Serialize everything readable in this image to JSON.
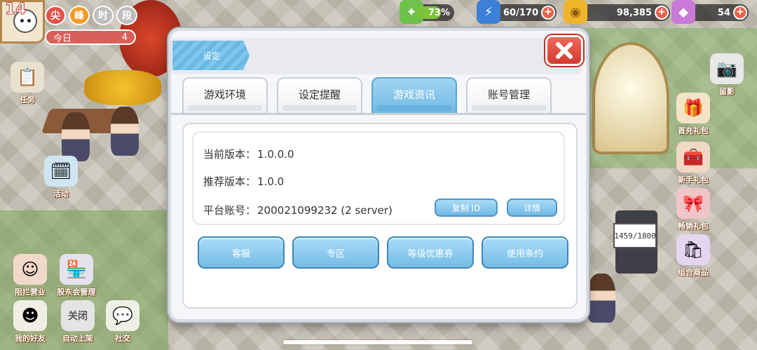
{
  "hud": {
    "level": "14",
    "badges": [
      "尖",
      "峰",
      "时",
      "段"
    ],
    "today_label": "今日",
    "today_value": "4",
    "progress_percent": "73%",
    "progress_fraction": 0.73,
    "energy": "60/170",
    "coins": "98,385",
    "gems": "54"
  },
  "side_left": [
    {
      "label": "任务"
    },
    {
      "label": "活动"
    },
    {
      "label": "阻拦营业"
    },
    {
      "label": "股东会管理"
    },
    {
      "label": "我的好友"
    },
    {
      "label": "自动上架"
    },
    {
      "label": "社交"
    }
  ],
  "side_right": [
    {
      "label": "留影"
    },
    {
      "label": "首充礼包"
    },
    {
      "label": "新手礼包"
    },
    {
      "label": "畅销礼包"
    },
    {
      "label": "组合商品"
    }
  ],
  "scene": {
    "stand_sign": "1459/1800",
    "closed_label": "关闭"
  },
  "dialog": {
    "title": "设定",
    "tabs": [
      "游戏环境",
      "设定提醒",
      "游戏资讯",
      "账号管理"
    ],
    "active_tab_index": 2,
    "info": {
      "current_version_label": "当前版本：",
      "current_version": "1.0.0.0",
      "recommended_version_label": "推荐版本：",
      "recommended_version": "1.0.0",
      "account_label": "平台账号：",
      "account_value": "200021099232 (2 server)",
      "copy_id_button": "复制 ID",
      "details_button": "详情"
    },
    "actions": [
      "客服",
      "专区",
      "等级优惠券",
      "使用条约"
    ]
  }
}
